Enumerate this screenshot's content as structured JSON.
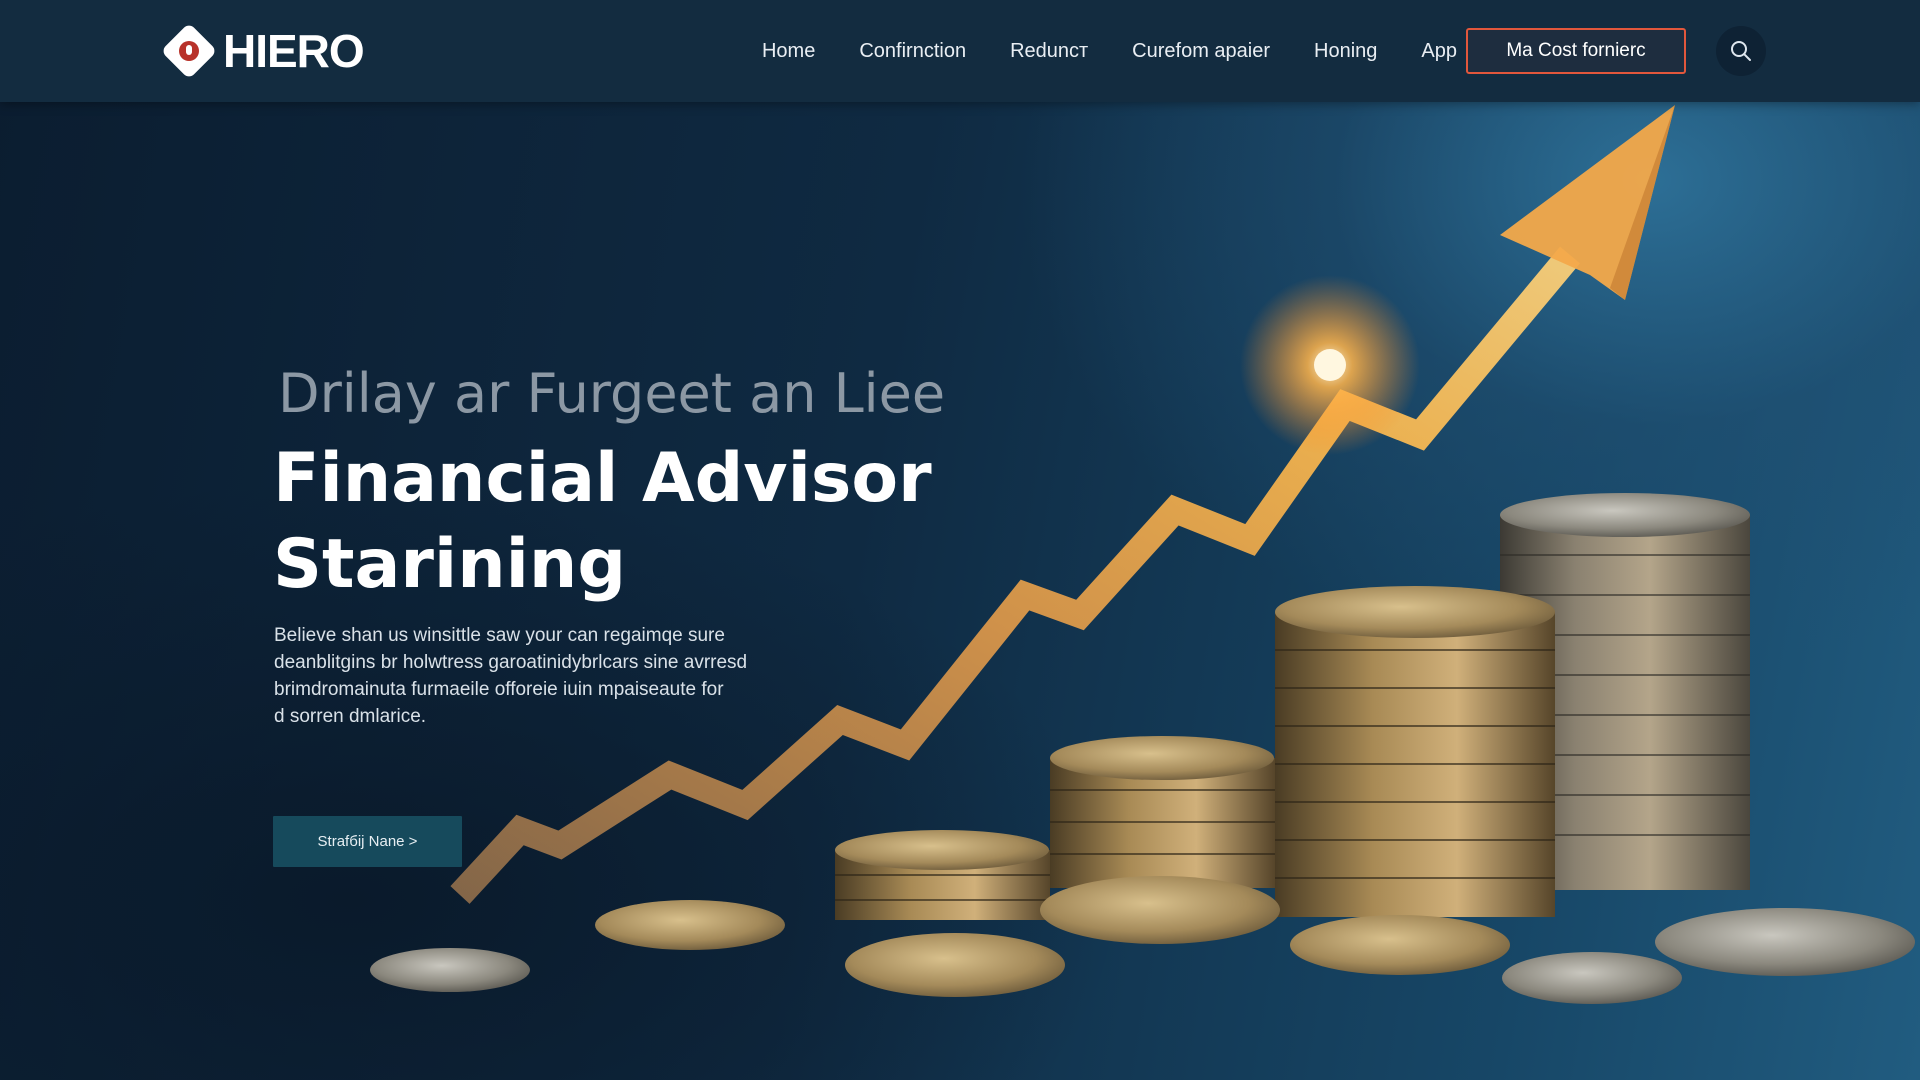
{
  "brand": {
    "logo_text": "HIERO"
  },
  "nav": {
    "items": [
      {
        "label": "Home"
      },
      {
        "label": "Confirnction"
      },
      {
        "label": "Reduncт"
      },
      {
        "label": "Curefom apaier"
      },
      {
        "label": "Honing"
      },
      {
        "label": "App"
      }
    ],
    "cta_label": "Ma Cost fornierc",
    "search_icon": "search-icon"
  },
  "hero": {
    "eyebrow": "Drilay ar Furgeet an Liee",
    "headline_lines": [
      "Financial Advisor",
      "Starining"
    ],
    "description_lines": [
      "Believe shan us winsittle saw your can regaimqe sure",
      "deanblitgins br holwtress garoatinidybrlcars sine avrresd",
      "brimdromainuta furmaeile offoreie iuin mpaiseaute for",
      "d sorren dmlarice."
    ],
    "button_label": "Strafбij Nane >"
  },
  "colors": {
    "nav_bg": "#132c40",
    "accent": "#e2573c",
    "button_bg": "#164a5c",
    "arrow": "#f4b44a"
  },
  "icons": [
    "logo-icon",
    "search-icon",
    "growth-arrow",
    "coin-stacks"
  ]
}
